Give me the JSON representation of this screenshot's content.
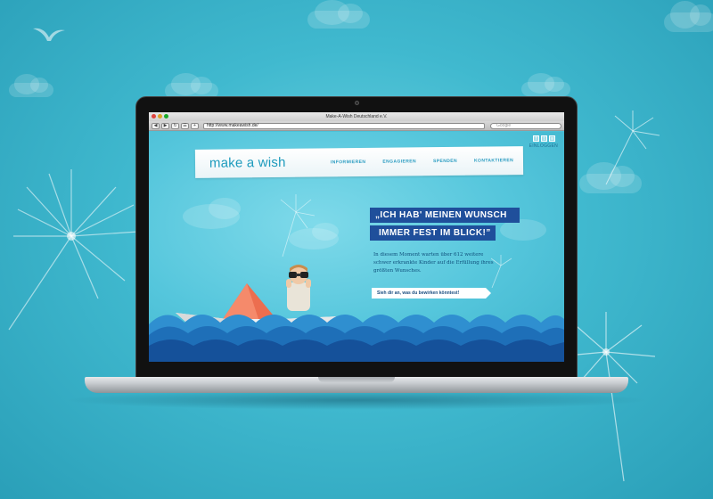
{
  "browser": {
    "window_title": "Make-A-Wish Deutschland e.V.",
    "url": "http://www.makeawish.de/",
    "search_placeholder": "Google"
  },
  "site": {
    "logo": "make a wish",
    "social": [
      "f",
      "t",
      "rss"
    ],
    "login": "EINLOGGEN",
    "nav": [
      "INFORMIEREN",
      "ENGAGIEREN",
      "SPENDEN",
      "KONTAKTIEREN"
    ],
    "headline_line1": "„ICH HAB' MEINEN WUNSCH",
    "headline_line2": "IMMER FEST IM BLICK!”",
    "intro": "In diesem Moment warten über 612 weitere schwer erkrankte Kinder auf die Erfüllung ihres größten Wunsches.",
    "cta": "Sieh dir an, was du bewirken könntest!"
  },
  "colors": {
    "accent_blue": "#1f4f9b",
    "logo_teal": "#1e9bbd",
    "boat_orange": "#ec6e4f"
  }
}
